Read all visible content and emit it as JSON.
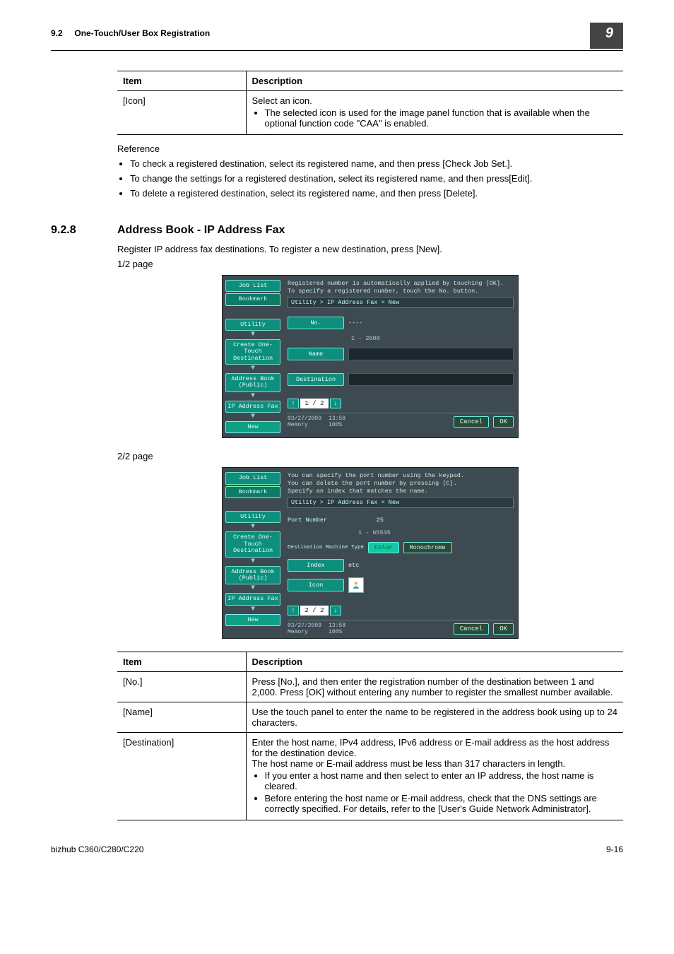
{
  "header": {
    "section_ref": "9.2",
    "section_title": "One-Touch/User Box Registration",
    "chapter_badge": "9"
  },
  "table1": {
    "head_item": "Item",
    "head_desc": "Description",
    "row1_item": "[Icon]",
    "row1_desc_l1": "Select an icon.",
    "row1_desc_li1": "The selected icon is used for the image panel function that is available when the optional function code \"CAA\" is enabled."
  },
  "reference": {
    "title": "Reference",
    "b1": "To check a registered destination, select its registered name, and then press [Check Job Set.].",
    "b2": "To change the settings for a registered destination, select its registered name, and then press[Edit].",
    "b3": "To delete a registered destination, select its registered name, and then press [Delete]."
  },
  "section": {
    "num": "9.2.8",
    "title": "Address Book - IP Address Fax"
  },
  "intro": "Register IP address fax destinations. To register a new destination, press [New].",
  "page_labels": {
    "p1": "1/2 page",
    "p2": "2/2 page"
  },
  "shot_common": {
    "side": {
      "job_list": "Job List",
      "bookmark": "Bookmark",
      "utility": "Utility",
      "create": "Create One-Touch Destination",
      "addrbook": "Address Book (Public)",
      "ipfax": "IP Address Fax",
      "new": "New"
    },
    "breadcrumb": "Utility > IP Address Fax > New",
    "footer": {
      "date": "03/27/2009",
      "time": "13:58",
      "mem_label": "Memory",
      "mem_val": "100%",
      "cancel": "Cancel",
      "ok": "OK"
    }
  },
  "shot1": {
    "top1": "Registered number is automatically applied by touching [OK].",
    "top2": "To specify a registered number, touch the No. button.",
    "no_label": "No.",
    "no_value": "----",
    "no_range": "1  -  2000",
    "name_label": "Name",
    "dest_label": "Destination",
    "pager": "1 / 2"
  },
  "shot2": {
    "top1": "You can specify the port number using the keypad.",
    "top2": "You can delete the port number by pressing [C].",
    "top3": "Specify an index that matches the name.",
    "port_label": "Port Number",
    "port_value": "25",
    "port_range": "1  -  65535",
    "dmt_label": "Destination Machine Type",
    "color": "Color",
    "mono": "Monochrome",
    "index_label": "Index",
    "index_value": "etc",
    "icon_label": "Icon",
    "pager": "2 / 2"
  },
  "table2": {
    "head_item": "Item",
    "head_desc": "Description",
    "r1_item": "[No.]",
    "r1_desc": "Press [No.], and then enter the registration number of the destination between 1 and 2,000. Press [OK] without entering any number to register the smallest number available.",
    "r2_item": "[Name]",
    "r2_desc": "Use the touch panel to enter the name to be registered in the address book using up to 24 characters.",
    "r3_item": "[Destination]",
    "r3_desc_l1": "Enter the host name, IPv4 address, IPv6 address or E-mail address as the host address for the destination device.",
    "r3_desc_l2": "The host name or E-mail address must be less than 317 characters in length.",
    "r3_li1": "If you enter a host name and then select to enter an IP address, the host name is cleared.",
    "r3_li2": "Before entering the host name or E-mail address, check that the DNS settings are correctly specified. For details, refer to the [User's Guide Network Administrator]."
  },
  "footer_page": {
    "left": "bizhub C360/C280/C220",
    "right": "9-16"
  }
}
